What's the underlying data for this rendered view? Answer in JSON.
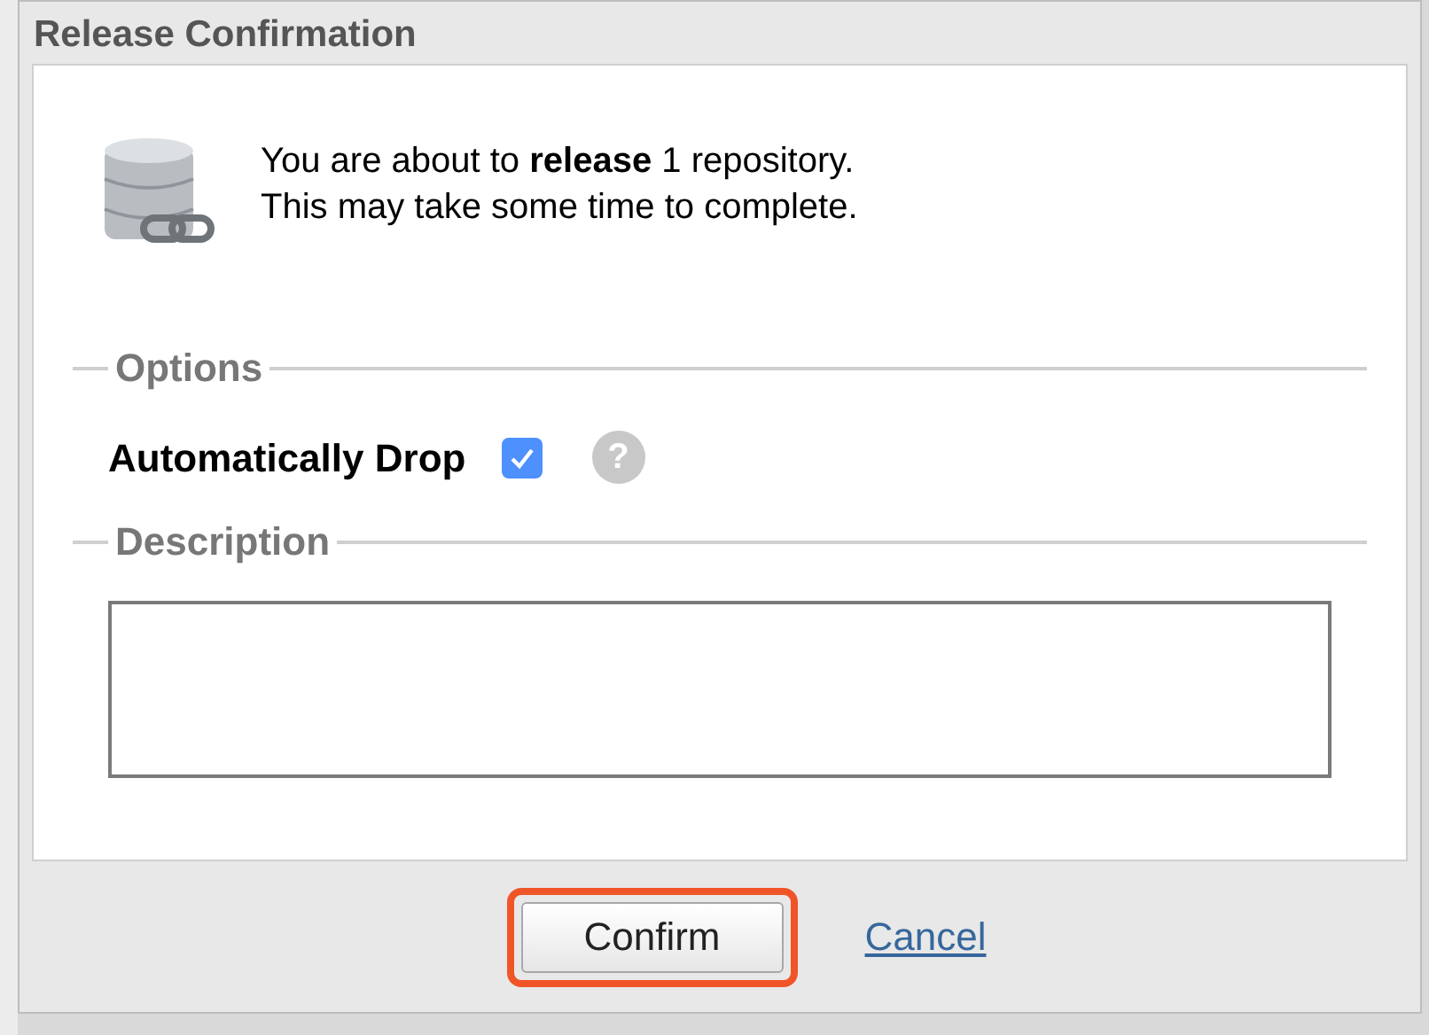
{
  "dialog": {
    "title": "Release Confirmation"
  },
  "message": {
    "lines": [
      "You are about to **release** 1 repository.",
      "This may take some time to complete."
    ]
  },
  "options": {
    "legend": "Options",
    "checkbox": {
      "label": "Automatically Drop",
      "checked": true
    },
    "help": {
      "glyph": "?"
    }
  },
  "description": {
    "legend": "Description"
  },
  "buttons": {
    "confirm": {
      "label": "Confirm",
      "highlighted": true
    },
    "cancel": {
      "label": "Cancel"
    }
  }
}
